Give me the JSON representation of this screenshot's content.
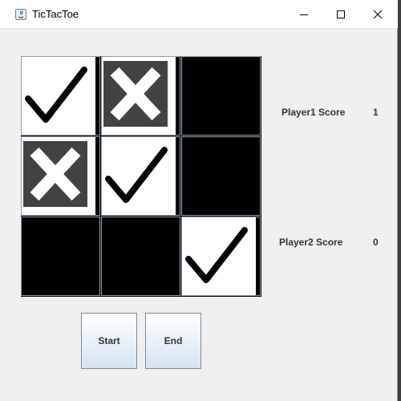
{
  "window": {
    "title": "TicTacToe",
    "icons": {
      "app": "java-app-icon",
      "minimize": "minimize-icon",
      "maximize": "maximize-icon",
      "close": "close-icon"
    }
  },
  "board": {
    "cells": [
      {
        "mark": "check",
        "stripe": true
      },
      {
        "mark": "x",
        "stripe": true
      },
      {
        "mark": "empty",
        "stripe": false
      },
      {
        "mark": "x",
        "stripe": true
      },
      {
        "mark": "check",
        "stripe": true
      },
      {
        "mark": "empty",
        "stripe": false
      },
      {
        "mark": "empty",
        "stripe": false
      },
      {
        "mark": "empty",
        "stripe": false
      },
      {
        "mark": "check",
        "stripe": true
      }
    ]
  },
  "scores": {
    "player1": {
      "label": "Player1 Score",
      "value": "1"
    },
    "player2": {
      "label": "Player2 Score",
      "value": "0"
    }
  },
  "buttons": {
    "start": "Start",
    "end": "End"
  },
  "colors": {
    "board_bg": "#000000",
    "cell_border": "#8f9db0",
    "x_tile": "#424242",
    "x_stroke": "#ffffff",
    "check_stroke": "#000000",
    "window_bg": "#f0f0f0"
  }
}
